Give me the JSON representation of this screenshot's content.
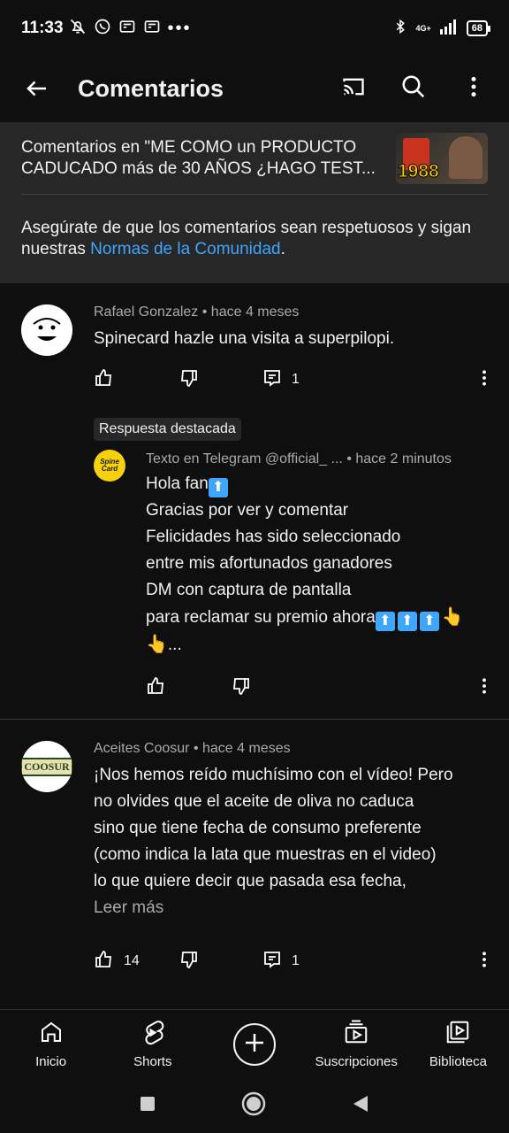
{
  "status_bar": {
    "time": "11:33",
    "network": "4G+",
    "battery": "68"
  },
  "app_bar": {
    "title": "Comentarios"
  },
  "header": {
    "video_title": "Comentarios en \"ME COMO un PRODUCTO CADUCADO más de 30 AÑOS ¿HAGO TEST...",
    "thumbnail_text": "1988",
    "guidelines_text": "Asegúrate de que los comentarios sean respetuosos y sigan nuestras ",
    "guidelines_link": "Normas de la Comunidad",
    "guidelines_end": "."
  },
  "comments": [
    {
      "author": "Rafael Gonzalez",
      "time": "hace 4 meses",
      "text": "Spinecard hazle una visita a superpilopi.",
      "likes": "",
      "replies": "1"
    },
    {
      "author": "Aceites Coosur",
      "time": "hace 4 meses",
      "avatar_text": "COOSUR",
      "text_lines": [
        "¡Nos hemos reído muchísimo con el vídeo! Pero",
        "no olvides que el aceite de oliva no caduca",
        "sino que tiene fecha de consumo preferente",
        "(como indica la lata que muestras en el video)",
        "lo que quiere decir que pasada esa fecha,"
      ],
      "read_more": "Leer más",
      "likes": "14",
      "replies": "1"
    }
  ],
  "featured_reply": {
    "badge": "Respuesta destacada",
    "author": "Texto en Telegram @official_ ...",
    "time": "hace 2 minutos",
    "avatar_text": "Spine Card",
    "lines": [
      "Hola fan",
      "Gracias por ver y comentar",
      "Felicidades has sido seleccionado",
      "entre mis afortunados ganadores",
      "DM con captura de pantalla",
      "para reclamar su premio ahora"
    ],
    "ellipsis": "..."
  },
  "bottom_nav": {
    "home": "Inicio",
    "shorts": "Shorts",
    "subscriptions": "Suscripciones",
    "library": "Biblioteca"
  },
  "colors": {
    "background": "#0f0f0f",
    "panel": "#272727",
    "link": "#3ea6ff",
    "secondary_text": "#aaaaaa"
  }
}
